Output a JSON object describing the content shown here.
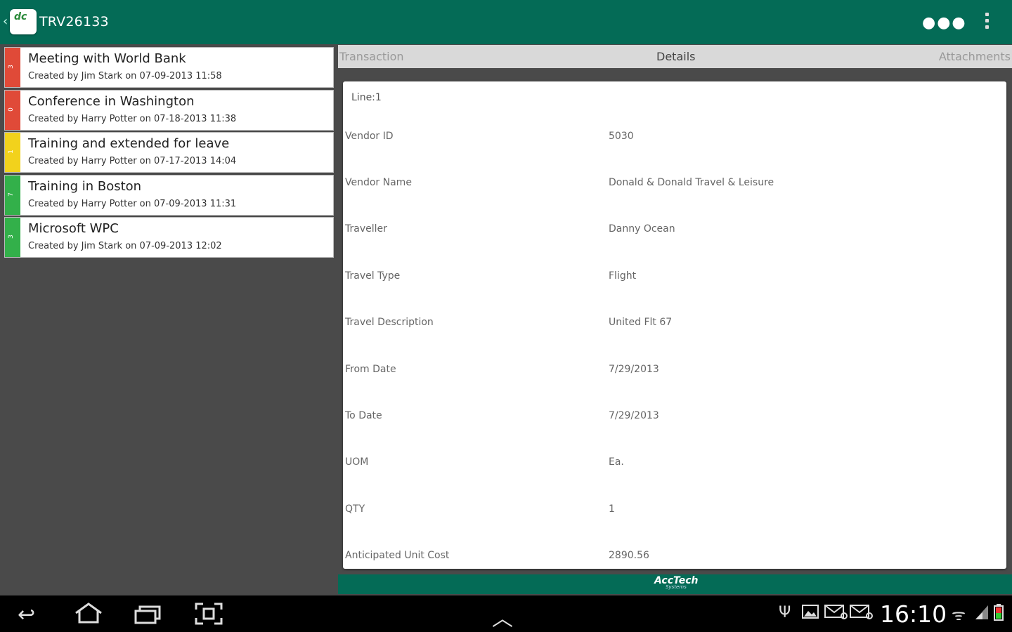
{
  "header": {
    "back_glyph": "‹",
    "logo_text": "dc",
    "title": "TRV26133",
    "overflow_glyph": "●●●"
  },
  "list": {
    "items": [
      {
        "strip_color": "#e04a38",
        "strip_text": "3",
        "title": "Meeting with World Bank",
        "subtitle": "Created by Jim Stark on 07-09-2013 11:58"
      },
      {
        "strip_color": "#e04a38",
        "strip_text": "0",
        "title": "Conference in Washington",
        "subtitle": "Created by Harry Potter on 07-18-2013 11:38"
      },
      {
        "strip_color": "#f2d21c",
        "strip_text": "1",
        "title": "Training and extended for leave",
        "subtitle": "Created by Harry Potter on 07-17-2013 14:04"
      },
      {
        "strip_color": "#33b04a",
        "strip_text": "7",
        "title": "Training in Boston",
        "subtitle": "Created by Harry Potter on 07-09-2013 11:31"
      },
      {
        "strip_color": "#33b04a",
        "strip_text": "3",
        "title": "Microsoft WPC",
        "subtitle": "Created by Jim Stark on 07-09-2013 12:02"
      }
    ]
  },
  "tabs": {
    "transaction": "Transaction",
    "details": "Details",
    "attachments": "Attachments"
  },
  "details": {
    "line_header": "Line:1",
    "rows": [
      {
        "label": "Vendor ID",
        "value": "5030"
      },
      {
        "label": "Vendor Name",
        "value": "Donald & Donald Travel & Leisure"
      },
      {
        "label": "Traveller",
        "value": "Danny Ocean"
      },
      {
        "label": "Travel Type",
        "value": "Flight"
      },
      {
        "label": "Travel Description",
        "value": "United Flt 67"
      },
      {
        "label": "From Date",
        "value": "7/29/2013"
      },
      {
        "label": "To Date",
        "value": "7/29/2013"
      },
      {
        "label": "UOM",
        "value": "Ea."
      },
      {
        "label": "QTY",
        "value": "1"
      },
      {
        "label": "Anticipated Unit Cost",
        "value": "2890.56"
      }
    ]
  },
  "footer": {
    "brand": "AccTech",
    "brand_sub": "Systems"
  },
  "system_bar": {
    "back_glyph": "↩",
    "up_glyph": "︿",
    "usb_glyph": "Ψ",
    "wifi_glyph": "ᯤ",
    "time": "16:10"
  },
  "colors": {
    "accent": "#046b56",
    "panel_bg": "#4a4a4a"
  }
}
